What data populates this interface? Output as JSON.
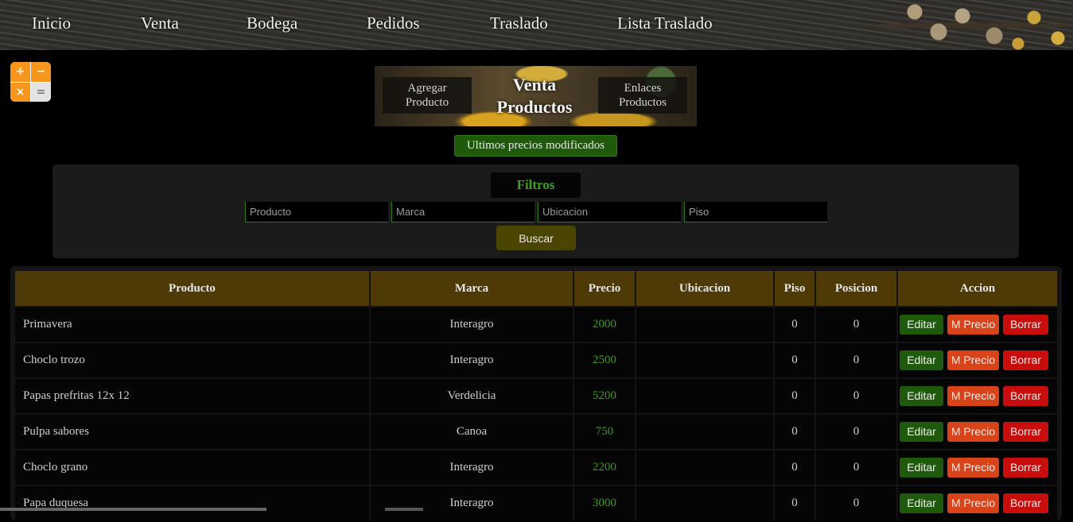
{
  "nav": {
    "items": [
      "Inicio",
      "Venta",
      "Bodega",
      "Pedidos",
      "Traslado",
      "Lista Traslado"
    ]
  },
  "banner": {
    "left_link_line1": "Agregar",
    "left_link_line2": "Producto",
    "title_line1": "Venta",
    "title_line2": "Productos",
    "right_link_line1": "Enlaces",
    "right_link_line2": "Productos"
  },
  "recent_prices_label": "Ultimos precios modificados",
  "filters": {
    "title": "Filtros",
    "producto_placeholder": "Producto",
    "marca_placeholder": "Marca",
    "ubicacion_placeholder": "Ubicacion",
    "piso_placeholder": "Piso",
    "search_label": "Buscar"
  },
  "table": {
    "headers": [
      "Producto",
      "Marca",
      "Precio",
      "Ubicacion",
      "Piso",
      "Posicion",
      "Accion"
    ],
    "action_labels": {
      "edit": "Editar",
      "price": "M Precio",
      "delete": "Borrar"
    },
    "rows": [
      {
        "producto": "Primavera",
        "marca": "Interagro",
        "precio": "2000",
        "ubicacion": "",
        "piso": "0",
        "posicion": "0"
      },
      {
        "producto": "Choclo trozo",
        "marca": "Interagro",
        "precio": "2500",
        "ubicacion": "",
        "piso": "0",
        "posicion": "0"
      },
      {
        "producto": "Papas prefritas 12x 12",
        "marca": "Verdelicia",
        "precio": "5200",
        "ubicacion": "",
        "piso": "0",
        "posicion": "0"
      },
      {
        "producto": "Pulpa sabores",
        "marca": "Canoa",
        "precio": "750",
        "ubicacion": "",
        "piso": "0",
        "posicion": "0"
      },
      {
        "producto": "Choclo grano",
        "marca": "Interagro",
        "precio": "2200",
        "ubicacion": "",
        "piso": "0",
        "posicion": "0"
      },
      {
        "producto": "Papa duquesa",
        "marca": "Interagro",
        "precio": "3000",
        "ubicacion": "",
        "piso": "0",
        "posicion": "0"
      }
    ]
  },
  "colors": {
    "header_bg": "#4d3a07",
    "price_green": "#3d9a1c",
    "edit_green": "#1f5a0c",
    "price_orange": "#d9431a",
    "delete_red": "#c80d0d"
  }
}
